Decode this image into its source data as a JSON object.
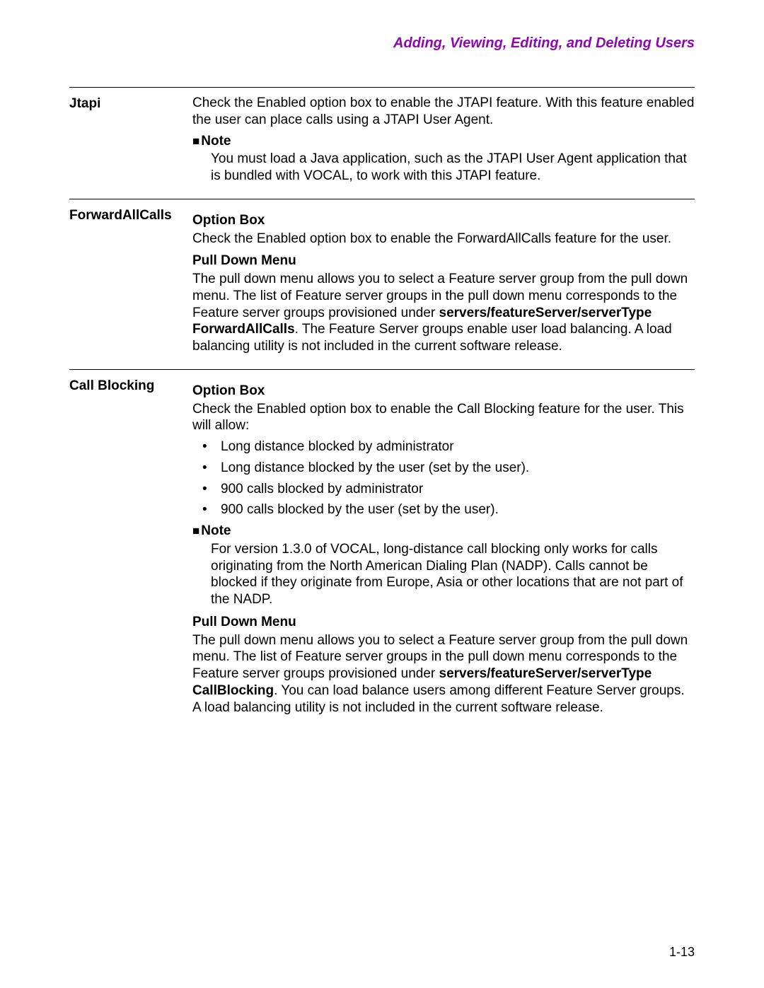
{
  "header": {
    "chapter_title": "Adding, Viewing, Editing, and Deleting Users"
  },
  "sections": {
    "jtapi": {
      "label": "Jtapi",
      "body": "Check the Enabled option box to enable the JTAPI feature. With this feature enabled the user can place calls using a JTAPI User Agent.",
      "note_label": "Note",
      "note_body": "You must load a Java application, such as the JTAPI User Agent application that is bundled with VOCAL, to work with this JTAPI feature."
    },
    "fac": {
      "label": "ForwardAllCalls",
      "optionbox_heading": "Option Box",
      "optionbox_body": "Check the Enabled option box to enable the ForwardAllCalls feature for the user.",
      "pulldown_heading": "Pull Down Menu",
      "pulldown_pre": "The pull down menu allows you to select a Feature server group from the pull down menu. The list of Feature server groups in the pull down menu corresponds to the Feature server groups provisioned under ",
      "pulldown_bold": "servers/featureServer/serverType ForwardAllCalls",
      "pulldown_post": ". The Feature Server groups enable user load balancing. A load balancing utility is not included in the current software release."
    },
    "cb": {
      "label": "Call Blocking",
      "optionbox_heading": "Option Box",
      "optionbox_body": "Check the Enabled option box to enable the Call Blocking feature for the user. This will allow:",
      "bullets": [
        "Long distance blocked by administrator",
        "Long distance blocked by the user (set by the user).",
        "900 calls blocked by administrator",
        "900 calls blocked by the user (set by the user)."
      ],
      "note_label": "Note",
      "note_body": "For version 1.3.0 of VOCAL, long-distance call blocking only works for calls originating from the North American Dialing Plan (NADP). Calls cannot be blocked if they originate from Europe, Asia or other locations that are not part of the NADP.",
      "pulldown_heading": "Pull Down Menu",
      "pulldown_pre": "The pull down menu allows you to select a Feature server group from the pull down menu. The list of Feature server groups in the pull down menu corresponds to the Feature server groups provisioned under ",
      "pulldown_bold": "servers/featureServer/serverType CallBlocking",
      "pulldown_post": ". You can load balance users among different Feature Server groups. A load balancing utility is not included in the current software release."
    }
  },
  "footer": {
    "page_number": "1-13"
  }
}
